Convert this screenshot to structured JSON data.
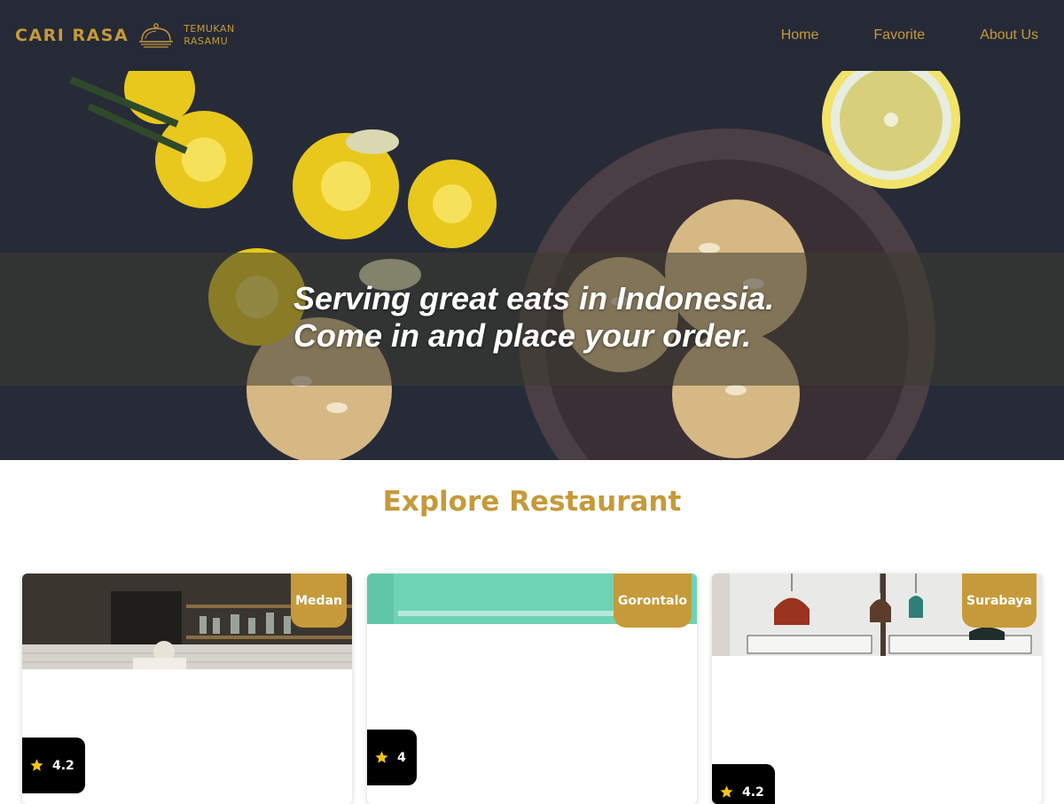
{
  "brand": {
    "name": "CARI RASA",
    "tagline_line1": "TEMUKAN",
    "tagline_line2": "RASAMU",
    "icon": "cloche-icon"
  },
  "nav": [
    {
      "label": "Home"
    },
    {
      "label": "Favorite"
    },
    {
      "label": "About Us"
    }
  ],
  "hero": {
    "line1": "Serving great eats in Indonesia.",
    "line2": "Come in and place your order."
  },
  "explore": {
    "title": "Explore Restaurant"
  },
  "restaurants": [
    {
      "city": "Medan",
      "rating": "4.2"
    },
    {
      "city": "Gorontalo",
      "rating": "4"
    },
    {
      "city": "Surabaya",
      "rating": "4.2"
    }
  ],
  "colors": {
    "accent": "#c69a3a",
    "header_bg": "#252a36",
    "rating_bg": "#000000",
    "star": "#f5c518"
  }
}
